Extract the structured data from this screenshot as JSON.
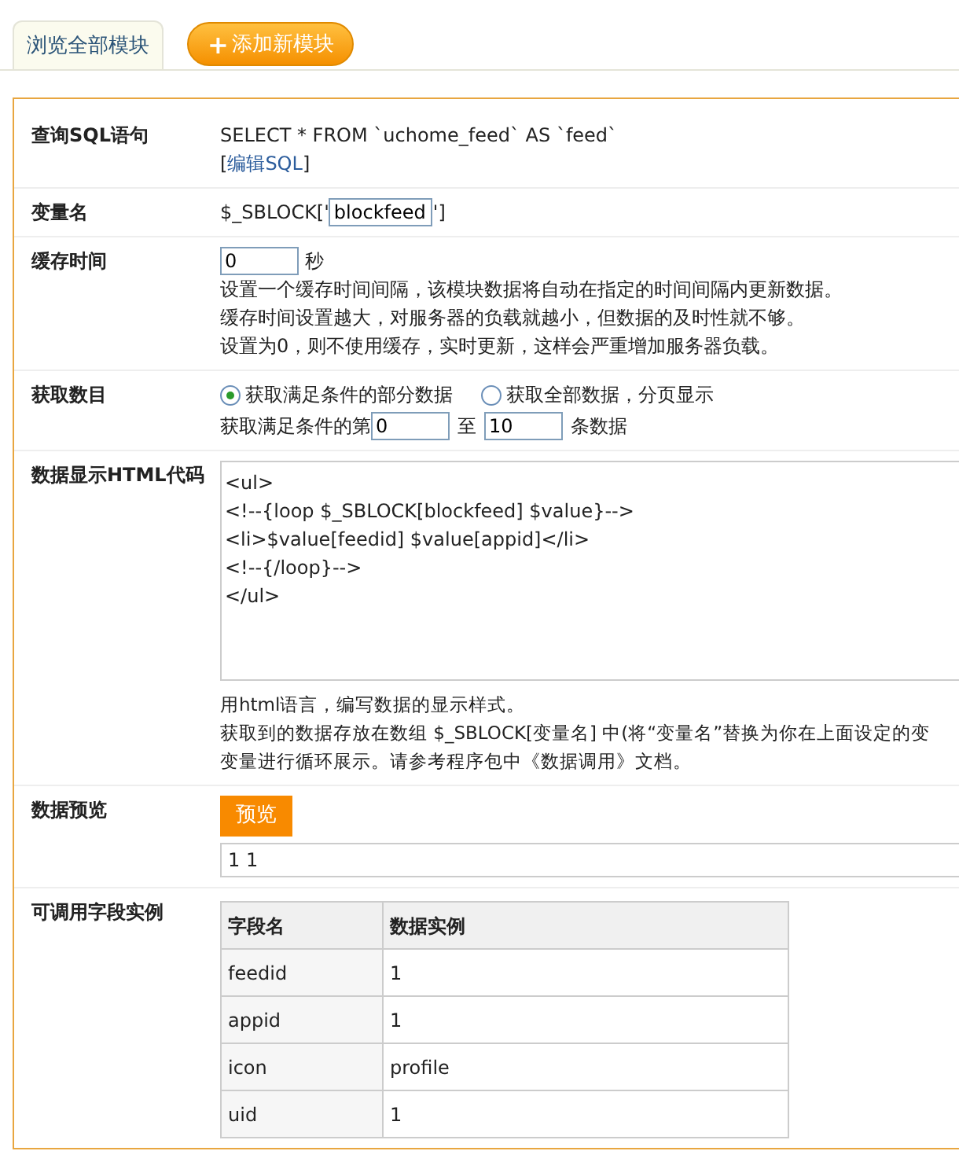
{
  "tabs": [
    {
      "label": "浏览全部模块",
      "selected": true
    }
  ],
  "add_button": {
    "icon": "+",
    "label": "添加新模块"
  },
  "form": {
    "sql": {
      "label": "查询SQL语句",
      "query": "SELECT * FROM `uchome_feed` AS `feed`",
      "edit_prefix": "[",
      "edit_link": "编辑SQL",
      "edit_suffix": "]"
    },
    "variable": {
      "label": "变量名",
      "prefix": "$_SBLOCK['",
      "value": "blockfeed",
      "suffix": "']"
    },
    "cache": {
      "label": "缓存时间",
      "value": "0",
      "unit": "秒",
      "notes": [
        "设置一个缓存时间间隔，该模块数据将自动在指定的时间间隔内更新数据。",
        "缓存时间设置越大，对服务器的负载就越小，但数据的及时性就不够。",
        "设置为0，则不使用缓存，实时更新，这样会严重增加服务器负载。"
      ]
    },
    "count": {
      "label": "获取数目",
      "options": [
        {
          "label": "获取满足条件的部分数据",
          "selected": true
        },
        {
          "label": "获取全部数据，分页显示",
          "selected": false
        }
      ],
      "range_prefix": "获取满足条件的第",
      "from": "0",
      "range_mid": "至",
      "to": "10",
      "range_suffix": "条数据"
    },
    "html": {
      "label": "数据显示HTML代码",
      "code": [
        "<ul>",
        "<!--{loop $_SBLOCK[blockfeed] $value}-->",
        "<li>$value[feedid] $value[appid]</li>",
        "<!--{/loop}-->",
        "</ul>"
      ],
      "notes": [
        "用html语言，编写数据的显示样式。",
        "获取到的数据存放在数组 $_SBLOCK[变量名] 中(将“变量名”替换为你在上面设定的变",
        "变量进行循环展示。请参考程序包中《数据调用》文档。"
      ]
    },
    "preview": {
      "label": "数据预览",
      "button": "预览",
      "output": "1 1"
    },
    "fields": {
      "label": "可调用字段实例",
      "columns": [
        "字段名",
        "数据实例"
      ],
      "rows": [
        [
          "feedid",
          "1"
        ],
        [
          "appid",
          "1"
        ],
        [
          "icon",
          "profile"
        ],
        [
          "uid",
          "1"
        ]
      ]
    }
  }
}
